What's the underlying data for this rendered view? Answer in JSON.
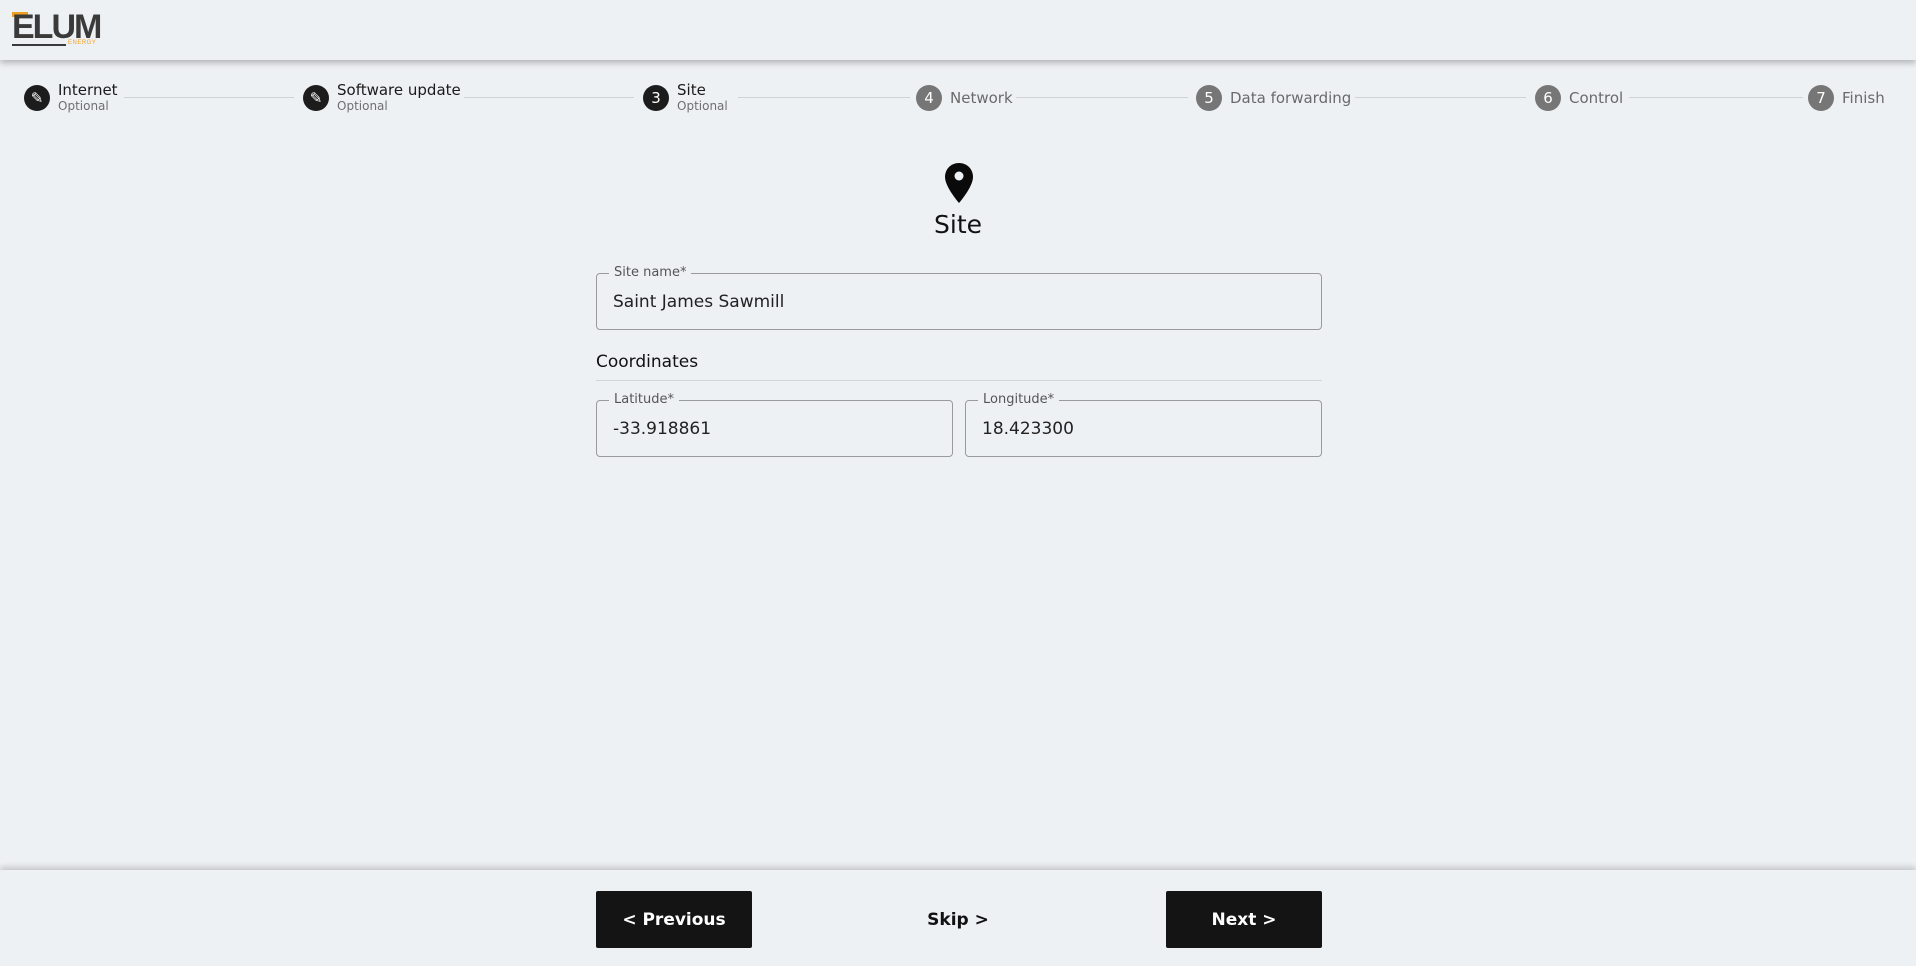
{
  "logo": {
    "wordmark": "ELUM",
    "tagline": "ENERGY"
  },
  "stepper": {
    "steps": [
      {
        "badge": "✎",
        "label": "Internet",
        "sub": "Optional",
        "state": "completed"
      },
      {
        "badge": "✎",
        "label": "Software update",
        "sub": "Optional",
        "state": "completed"
      },
      {
        "badge": "3",
        "label": "Site",
        "sub": "Optional",
        "state": "active"
      },
      {
        "badge": "4",
        "label": "Network",
        "sub": "",
        "state": "pending"
      },
      {
        "badge": "5",
        "label": "Data forwarding",
        "sub": "",
        "state": "pending"
      },
      {
        "badge": "6",
        "label": "Control",
        "sub": "",
        "state": "pending"
      },
      {
        "badge": "7",
        "label": "Finish",
        "sub": "",
        "state": "pending"
      }
    ]
  },
  "page": {
    "icon": "location-pin-icon",
    "title": "Site"
  },
  "form": {
    "site_name": {
      "label": "Site name*",
      "value": "Saint James Sawmill"
    },
    "coordinates_heading": "Coordinates",
    "latitude": {
      "label": "Latitude*",
      "value": "-33.918861"
    },
    "longitude": {
      "label": "Longitude*",
      "value": "18.423300"
    }
  },
  "footer": {
    "previous_label": "< Previous",
    "skip_label": "Skip >",
    "next_label": "Next >"
  },
  "colors": {
    "accent": "#f0a020",
    "dark": "#141414",
    "background": "#eef1f4",
    "step_pending": "#767676"
  }
}
